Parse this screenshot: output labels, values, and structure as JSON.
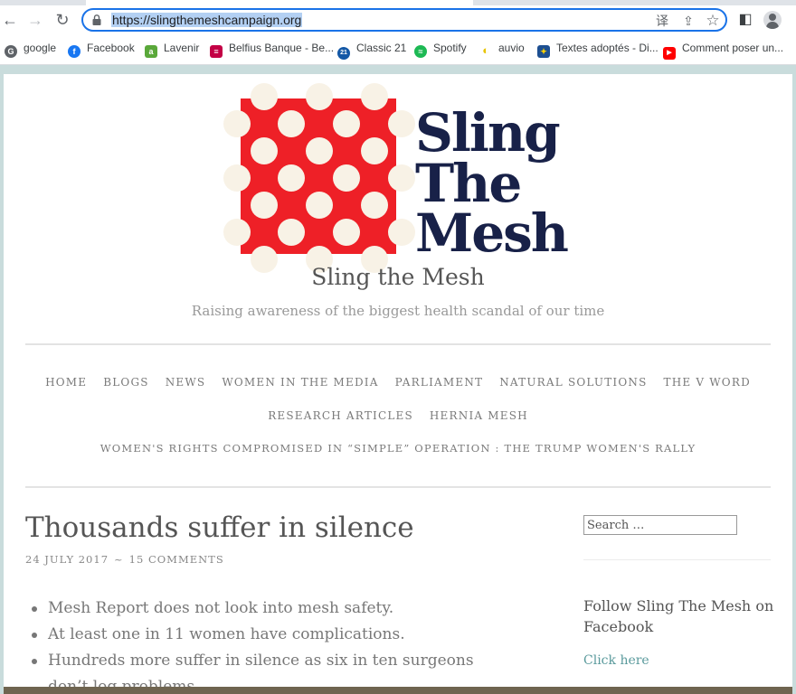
{
  "browser": {
    "url": "https://slingthemeshcampaign.org",
    "back_glyph": "←",
    "forward_glyph": "→",
    "reload_glyph": "↻",
    "translate_glyph": "译",
    "share_glyph": "⇪",
    "star_glyph": "☆",
    "sidepanel_glyph": "◧"
  },
  "bookmarks": [
    {
      "label": "google",
      "icon": "chrome-icon",
      "color": "#5f6368",
      "glyph": "G"
    },
    {
      "label": "Facebook",
      "icon": "facebook-icon",
      "color": "#1877f2",
      "glyph": "f"
    },
    {
      "label": "Lavenir",
      "icon": "lavenir-icon",
      "color": "#5aa83a",
      "glyph": "a"
    },
    {
      "label": "Belfius Banque - Be...",
      "icon": "belfius-icon",
      "color": "#c30045",
      "glyph": "≡"
    },
    {
      "label": "Classic 21",
      "icon": "classic21-icon",
      "color": "#1458a6",
      "glyph": "21"
    },
    {
      "label": "Spotify",
      "icon": "spotify-icon",
      "color": "#1db954",
      "glyph": "≈"
    },
    {
      "label": "auvio",
      "icon": "auvio-icon",
      "color": "#e8c400",
      "glyph": "◐"
    },
    {
      "label": "Textes adoptés - Di...",
      "icon": "eu-parliament-icon",
      "color": "#1d4f91",
      "glyph": "✦"
    },
    {
      "label": "Comment poser un...",
      "icon": "youtube-icon",
      "color": "#ff0000",
      "glyph": "▶"
    }
  ],
  "site": {
    "logo_words": [
      "Sling",
      "The",
      "Mesh"
    ],
    "title": "Sling the Mesh",
    "tagline": "Raising awareness of the biggest health scandal of our time"
  },
  "nav": {
    "row1": [
      "HOME",
      "BLOGS",
      "NEWS",
      "WOMEN IN THE MEDIA",
      "PARLIAMENT",
      "NATURAL SOLUTIONS",
      "THE V WORD"
    ],
    "row2": [
      "RESEARCH ARTICLES",
      "HERNIA MESH"
    ],
    "row3": [
      "WOMEN'S RIGHTS COMPROMISED IN “SIMPLE” OPERATION : THE TRUMP WOMEN'S RALLY"
    ]
  },
  "post": {
    "title": "Thousands suffer in silence",
    "date": "24 JULY 2017",
    "separator": "~",
    "comments": "15 COMMENTS",
    "bullets": [
      "Mesh Report does not look into mesh safety.",
      "At least one in 11 women have complications.",
      "Hundreds more suffer in silence as six in ten surgeons don’t log problems."
    ]
  },
  "sidebar": {
    "search_placeholder": "Search …",
    "widget_title": "Follow Sling The Mesh on Facebook",
    "widget_link": "Click here"
  }
}
